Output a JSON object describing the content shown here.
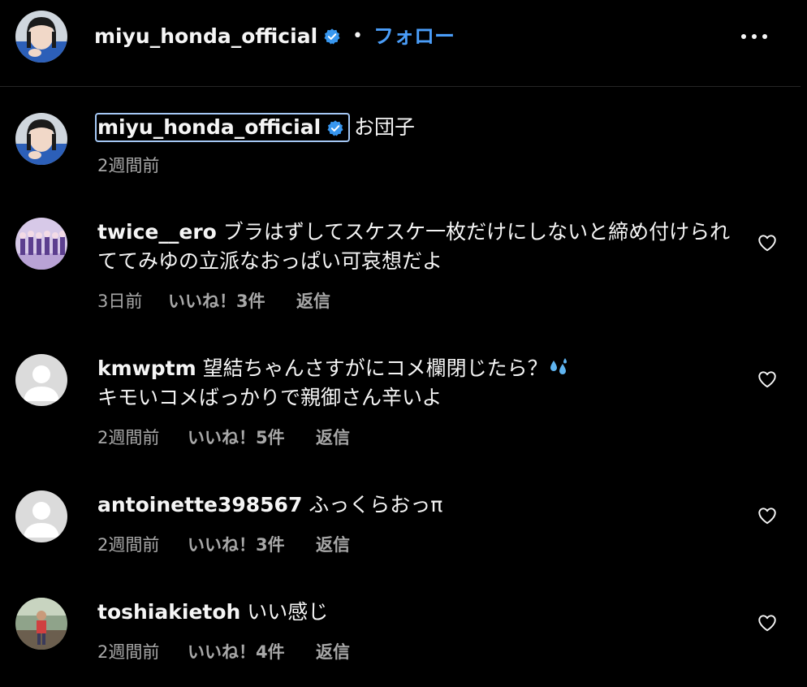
{
  "header": {
    "username": "miyu_honda_official",
    "dot": "•",
    "follow_label": "フォロー",
    "more_icon": "more-horizontal-icon"
  },
  "caption": {
    "username": "miyu_honda_official",
    "text": "お団子",
    "time": "2週間前"
  },
  "comments": [
    {
      "username": "twice__ero",
      "text": "ブラはずしてスケスケ一枚だけにしないと締め付けられててみゆの立派なおっぱい可哀想だよ",
      "time": "3日前",
      "likes": "いいね！3件",
      "reply": "返信"
    },
    {
      "username": "kmwptm",
      "text": "望結ちゃんさすがにコメ欄閉じたら？",
      "text_line2": "キモいコメばっかりで親御さん辛いよ",
      "emoji": "sweat-droplets-icon",
      "time": "2週間前",
      "likes": "いいね！5件",
      "reply": "返信"
    },
    {
      "username": "antoinette398567",
      "text": "ふっくらおっπ",
      "time": "2週間前",
      "likes": "いいね！3件",
      "reply": "返信"
    },
    {
      "username": "toshiakietoh",
      "text": "いい感じ",
      "time": "2週間前",
      "likes": "いいね！4件",
      "reply": "返信"
    }
  ],
  "colors": {
    "background": "#000000",
    "text": "#f5f5f5",
    "secondary": "#a8a8a8",
    "link": "#4a9df8",
    "verified": "#3897f0"
  }
}
